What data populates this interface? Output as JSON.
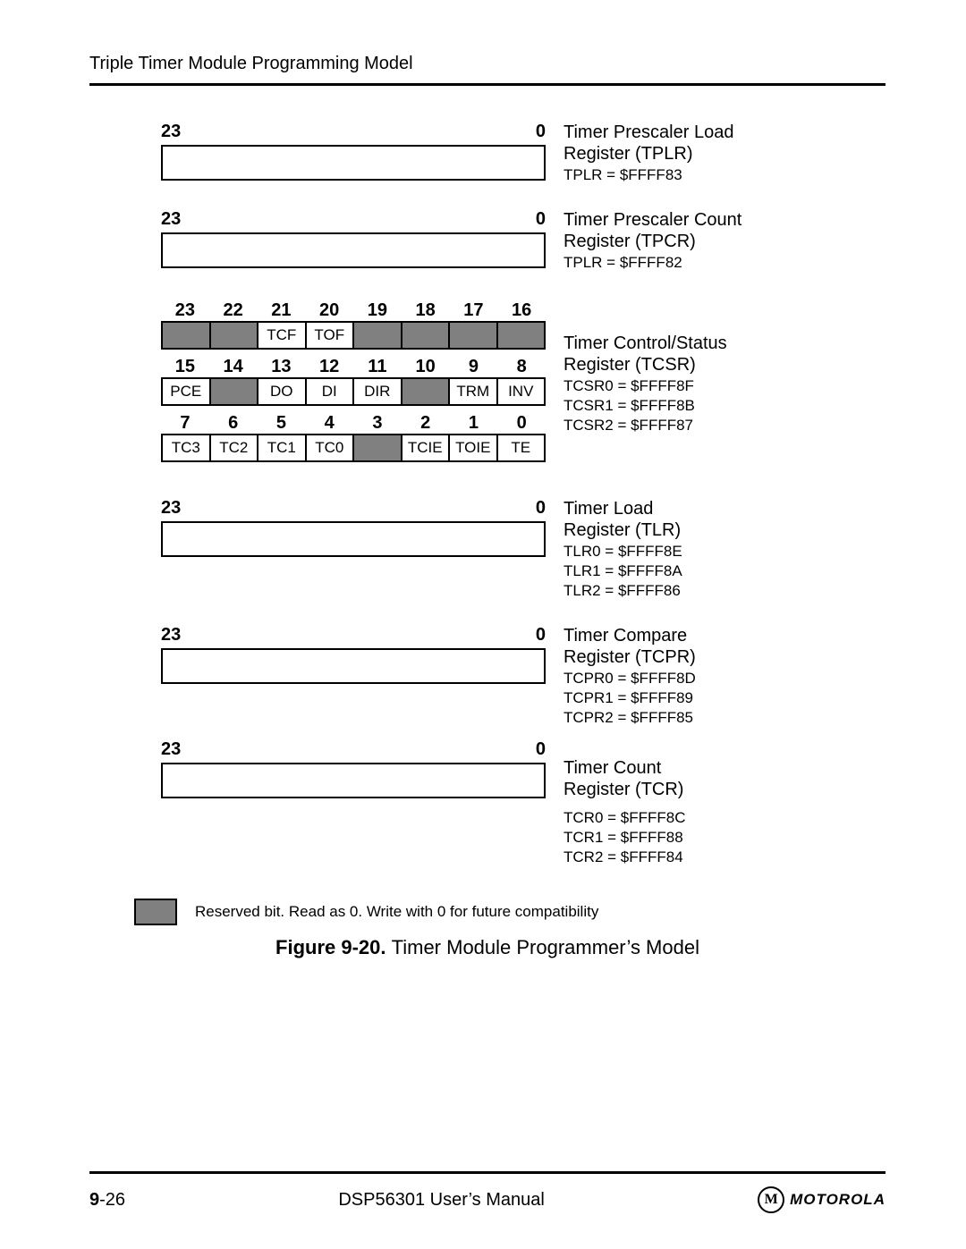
{
  "header": "Triple Timer Module Programming Model",
  "registers": {
    "tplr": {
      "hi": "23",
      "lo": "0",
      "name1": "Timer Prescaler Load",
      "name2": "Register (TPLR)",
      "addr": "TPLR = $FFFF83"
    },
    "tpcr": {
      "hi": "23",
      "lo": "0",
      "name1": "Timer Prescaler Count",
      "name2": "Register (TPCR)",
      "addr": "TPLR = $FFFF82"
    },
    "tcsr": {
      "name1": "Timer Control/Status",
      "name2": "Register (TCSR)",
      "addr0": "TCSR0 = $FFFF8F",
      "addr1": "TCSR1 = $FFFF8B",
      "addr2": "TCSR2 = $FFFF87",
      "row1_nums": [
        "23",
        "22",
        "21",
        "20",
        "19",
        "18",
        "17",
        "16"
      ],
      "row1_cells": [
        {
          "t": "",
          "r": true
        },
        {
          "t": "",
          "r": true
        },
        {
          "t": "TCF",
          "r": false
        },
        {
          "t": "TOF",
          "r": false
        },
        {
          "t": "",
          "r": true
        },
        {
          "t": "",
          "r": true
        },
        {
          "t": "",
          "r": true
        },
        {
          "t": "",
          "r": true
        }
      ],
      "row2_nums": [
        "15",
        "14",
        "13",
        "12",
        "11",
        "10",
        "9",
        "8"
      ],
      "row2_cells": [
        {
          "t": "PCE",
          "r": false
        },
        {
          "t": "",
          "r": true
        },
        {
          "t": "DO",
          "r": false
        },
        {
          "t": "DI",
          "r": false
        },
        {
          "t": "DIR",
          "r": false
        },
        {
          "t": "",
          "r": true
        },
        {
          "t": "TRM",
          "r": false
        },
        {
          "t": "INV",
          "r": false
        }
      ],
      "row3_nums": [
        "7",
        "6",
        "5",
        "4",
        "3",
        "2",
        "1",
        "0"
      ],
      "row3_cells": [
        {
          "t": "TC3",
          "r": false
        },
        {
          "t": "TC2",
          "r": false
        },
        {
          "t": "TC1",
          "r": false
        },
        {
          "t": "TC0",
          "r": false
        },
        {
          "t": "",
          "r": true
        },
        {
          "t": "TCIE",
          "r": false
        },
        {
          "t": "TOIE",
          "r": false
        },
        {
          "t": "TE",
          "r": false
        }
      ]
    },
    "tlr": {
      "hi": "23",
      "lo": "0",
      "name1": "Timer Load",
      "name2": "Register (TLR)",
      "a0": "TLR0 = $FFFF8E",
      "a1": "TLR1 = $FFFF8A",
      "a2": "TLR2 = $FFFF86"
    },
    "tcpr": {
      "hi": "23",
      "lo": "0",
      "name1": "Timer Compare",
      "name2": "Register (TCPR)",
      "a0": "TCPR0 = $FFFF8D",
      "a1": "TCPR1 = $FFFF89",
      "a2": "TCPR2 = $FFFF85"
    },
    "tcr": {
      "hi": "23",
      "lo": "0",
      "name1": "Timer Count",
      "name2": "Register (TCR)",
      "a0": "TCR0 = $FFFF8C",
      "a1": "TCR1 = $FFFF88",
      "a2": "TCR2 = $FFFF84"
    }
  },
  "legend": "Reserved bit. Read as 0. Write with 0 for future compatibility",
  "caption_bold": "Figure 9-20. ",
  "caption_rest": "Timer Module Programmer’s Model",
  "footer": {
    "chap": "9",
    "dash_page": "-26",
    "manual": "DSP56301 User’s Manual",
    "brand_glyph": "M",
    "brand_text": "MOTOROLA"
  }
}
